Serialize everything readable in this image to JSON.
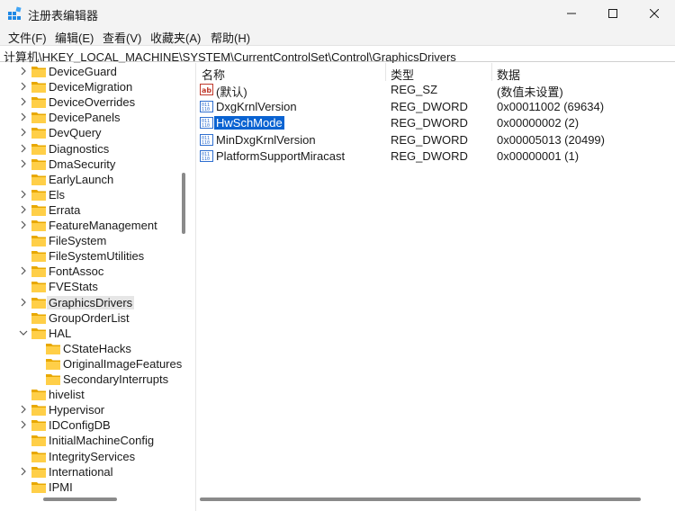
{
  "window": {
    "title": "注册表编辑器",
    "accent": "#0a63d2"
  },
  "menu": [
    "文件(F)",
    "编辑(E)",
    "查看(V)",
    "收藏夹(A)",
    "帮助(H)"
  ],
  "address": "计算机\\HKEY_LOCAL_MACHINE\\SYSTEM\\CurrentControlSet\\Control\\GraphicsDrivers",
  "tree": [
    {
      "label": "DeviceGuard",
      "chevron": "right"
    },
    {
      "label": "DeviceMigration",
      "chevron": "right"
    },
    {
      "label": "DeviceOverrides",
      "chevron": "right"
    },
    {
      "label": "DevicePanels",
      "chevron": "right"
    },
    {
      "label": "DevQuery",
      "chevron": "right"
    },
    {
      "label": "Diagnostics",
      "chevron": "right"
    },
    {
      "label": "DmaSecurity",
      "chevron": "right"
    },
    {
      "label": "EarlyLaunch",
      "chevron": "none"
    },
    {
      "label": "Els",
      "chevron": "right"
    },
    {
      "label": "Errata",
      "chevron": "right"
    },
    {
      "label": "FeatureManagement",
      "chevron": "right"
    },
    {
      "label": "FileSystem",
      "chevron": "none"
    },
    {
      "label": "FileSystemUtilities",
      "chevron": "none"
    },
    {
      "label": "FontAssoc",
      "chevron": "right"
    },
    {
      "label": "FVEStats",
      "chevron": "none"
    },
    {
      "label": "GraphicsDrivers",
      "chevron": "right",
      "selected": true
    },
    {
      "label": "GroupOrderList",
      "chevron": "none"
    },
    {
      "label": "HAL",
      "chevron": "down"
    },
    {
      "label": "CStateHacks",
      "chevron": "none",
      "child": true
    },
    {
      "label": "OriginalImageFeatures",
      "chevron": "none",
      "child": true
    },
    {
      "label": "SecondaryInterrupts",
      "chevron": "none",
      "child": true
    },
    {
      "label": "hivelist",
      "chevron": "none"
    },
    {
      "label": "Hypervisor",
      "chevron": "right"
    },
    {
      "label": "IDConfigDB",
      "chevron": "right"
    },
    {
      "label": "InitialMachineConfig",
      "chevron": "none"
    },
    {
      "label": "IntegrityServices",
      "chevron": "none"
    },
    {
      "label": "International",
      "chevron": "right"
    },
    {
      "label": "IPMI",
      "chevron": "none"
    }
  ],
  "columns": {
    "name": "名称",
    "type": "类型",
    "data": "数据"
  },
  "values": [
    {
      "icon": "string-value-icon",
      "name": "(默认)",
      "type": "REG_SZ",
      "data": "(数值未设置)"
    },
    {
      "icon": "binary-value-icon",
      "name": "DxgKrnlVersion",
      "type": "REG_DWORD",
      "data": "0x00011002 (69634)"
    },
    {
      "icon": "binary-value-icon",
      "name": "HwSchMode",
      "type": "REG_DWORD",
      "data": "0x00000002 (2)",
      "selected": true
    },
    {
      "icon": "binary-value-icon",
      "name": "MinDxgKrnlVersion",
      "type": "REG_DWORD",
      "data": "0x00005013 (20499)"
    },
    {
      "icon": "binary-value-icon",
      "name": "PlatformSupportMiracast",
      "type": "REG_DWORD",
      "data": "0x00000001 (1)"
    }
  ]
}
